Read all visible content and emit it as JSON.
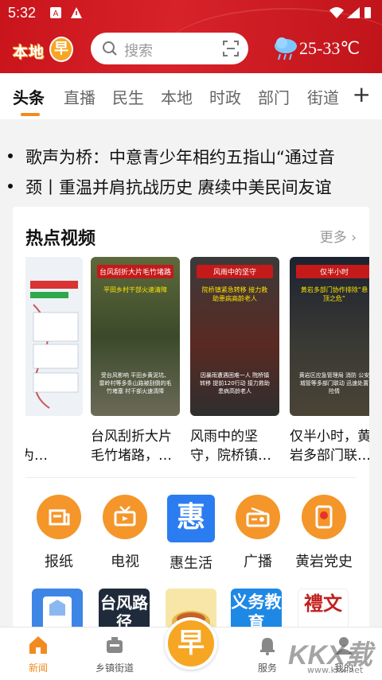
{
  "status_bar": {
    "time": "5:32"
  },
  "header": {
    "logo": {
      "text": "本地",
      "badge": "早"
    },
    "search": {
      "placeholder": "搜索"
    },
    "weather": {
      "icon": "cloud-rain-icon",
      "temperature": "25-33℃"
    }
  },
  "tabs": [
    {
      "label": "头条",
      "active": true
    },
    {
      "label": "直播"
    },
    {
      "label": "民生"
    },
    {
      "label": "本地"
    },
    {
      "label": "时政"
    },
    {
      "label": "部门"
    },
    {
      "label": "街道"
    }
  ],
  "news": [
    "歌声为桥：中意青少年相约五指山“通过音",
    "颈丨重温并肩抗战历史 赓续中美民间友谊"
  ],
  "hot_videos": {
    "title": "热点视频",
    "more": "更多",
    "items": [
      {
        "title": "“巴\n減弱为…",
        "cap": "",
        "sub": "",
        "bottom": ""
      },
      {
        "title": "台风刮折大片毛竹堵路，…",
        "cap": "台风刮折大片毛竹堵路",
        "sub": "平田乡村干部火速清障",
        "bottom": "受台风影响 平田乡黄泥坑、雷岭村等多条山路被刮倒的毛竹堵塞 村干部火速清障"
      },
      {
        "title": "风雨中的坚守，院桥镇…",
        "cap": "风雨中的坚守",
        "sub": "院桥镇紧急转移 接力救助患病高龄老人",
        "bottom": "因暴雨遭遇困难一人 院桥镇转移 提前120行动 接力救助患病高龄老人"
      },
      {
        "title": "仅半小时，黄岩多部门联…",
        "cap": "仅半小时",
        "sub": "黄岩多部门协作排除“悬顶之危”",
        "bottom": "黄岩区应急管理局 消防 公安 城管等多部门联动 迅速处置险情"
      }
    ]
  },
  "services": [
    {
      "label": "报纸",
      "icon": "newspaper-icon"
    },
    {
      "label": "电视",
      "icon": "tv-icon"
    },
    {
      "label": "惠生活",
      "icon": "hui-life-icon",
      "glyph": "惠"
    },
    {
      "label": "广播",
      "icon": "radio-icon"
    },
    {
      "label": "黄岩党史",
      "icon": "party-history-icon"
    }
  ],
  "services_row2": [
    {
      "icon": "map-app-icon",
      "text": ""
    },
    {
      "icon": "typhoon-path-icon",
      "text": "台风路径"
    },
    {
      "icon": "food-icon",
      "text": ""
    },
    {
      "icon": "education-icon",
      "text": "义务教育"
    },
    {
      "icon": "culture-icon",
      "text": "禮文"
    }
  ],
  "bottom_nav": [
    {
      "label": "新闻",
      "icon": "home-icon",
      "active": true
    },
    {
      "label": "乡镇街道",
      "icon": "town-icon"
    },
    {
      "label": "",
      "icon": "zao-center-icon",
      "glyph": "早"
    },
    {
      "label": "服务",
      "icon": "bell-icon"
    },
    {
      "label": "我的",
      "icon": "user-icon"
    }
  ],
  "watermark": {
    "text": "KKX载",
    "url": "www.kkx.net"
  },
  "colors": {
    "brand_red": "#d01c22",
    "accent_orange": "#f28b1f",
    "service_orange": "#f4962a"
  }
}
